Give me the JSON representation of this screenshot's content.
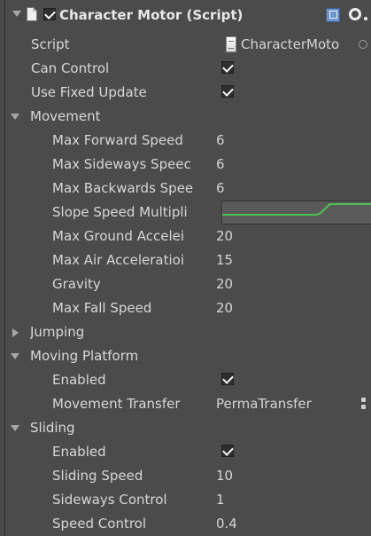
{
  "component": {
    "title": "Character Motor (Script)",
    "script_label": "Script",
    "script_value": "CharacterMoto",
    "can_control_label": "Can Control",
    "use_fixed_update_label": "Use Fixed Update"
  },
  "movement": {
    "section_label": "Movement",
    "fields": [
      {
        "label": "Max Forward Speed",
        "value": "6"
      },
      {
        "label": "Max Sideways Speec",
        "value": "6"
      },
      {
        "label": "Max Backwards Spee",
        "value": "6"
      },
      {
        "label": "Slope Speed Multipli",
        "value": ""
      },
      {
        "label": "Max Ground Accelei",
        "value": "20"
      },
      {
        "label": "Max Air Acceleratioi",
        "value": "15"
      },
      {
        "label": "Gravity",
        "value": "20"
      },
      {
        "label": "Max Fall Speed",
        "value": "20"
      }
    ]
  },
  "jumping": {
    "section_label": "Jumping"
  },
  "moving_platform": {
    "section_label": "Moving Platform",
    "enabled_label": "Enabled",
    "movement_transfer_label": "Movement Transfer",
    "movement_transfer_value": "PermaTransfer"
  },
  "sliding": {
    "section_label": "Sliding",
    "enabled_label": "Enabled",
    "fields": [
      {
        "label": "Sliding Speed",
        "value": "10"
      },
      {
        "label": "Sideways Control",
        "value": "1"
      },
      {
        "label": "Speed Control",
        "value": "0.4"
      }
    ]
  },
  "colors": {
    "background": "#4b4b4b",
    "text": "#d8d8d8",
    "curve": "#4ec24e",
    "blue_icon": "#6d96cf"
  },
  "icons": {
    "foldout_expanded": "down-arrow",
    "foldout_collapsed": "right-arrow",
    "checkbox": "check-icon",
    "script": "script-file-icon",
    "settings": "gear-icon"
  }
}
